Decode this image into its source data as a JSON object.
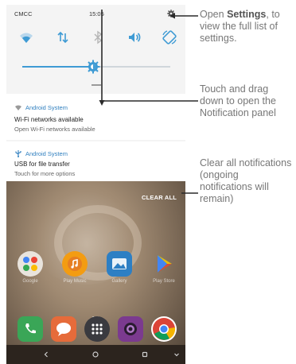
{
  "status_bar": {
    "carrier": "CMCC",
    "time": "15:05"
  },
  "quick_settings": {
    "tiles": [
      "wifi-icon",
      "data-arrows-icon",
      "bluetooth-icon",
      "volume-icon",
      "auto-rotate-icon"
    ],
    "brightness": 0.48
  },
  "notifications": [
    {
      "app": "Android System",
      "icon": "wifi-icon",
      "title": "Wi-Fi networks available",
      "body": "Open Wi-Fi networks available"
    },
    {
      "app": "Android System",
      "icon": "usb-icon",
      "title": "USB for file transfer",
      "body": "Touch for more options"
    }
  ],
  "clear_all_label": "CLEAR ALL",
  "home_apps": [
    {
      "label": "Google"
    },
    {
      "label": "Play Music"
    },
    {
      "label": "Gallery"
    },
    {
      "label": "Play Store"
    }
  ],
  "dock_apps": [
    "phone-icon",
    "messages-icon",
    "app-drawer-icon",
    "camera-icon",
    "chrome-icon"
  ],
  "callouts": {
    "settings_pre": "Open ",
    "settings_bold": "Settings",
    "settings_post": ", to view the full list of settings.",
    "drag": "Touch and drag down to open the Notification panel",
    "clear": "Clear all notifications (ongoing notifications will remain)"
  },
  "colors": {
    "accent": "#3f9bd4",
    "link_blue": "#2f7fbf",
    "callout_gray": "#777777"
  }
}
